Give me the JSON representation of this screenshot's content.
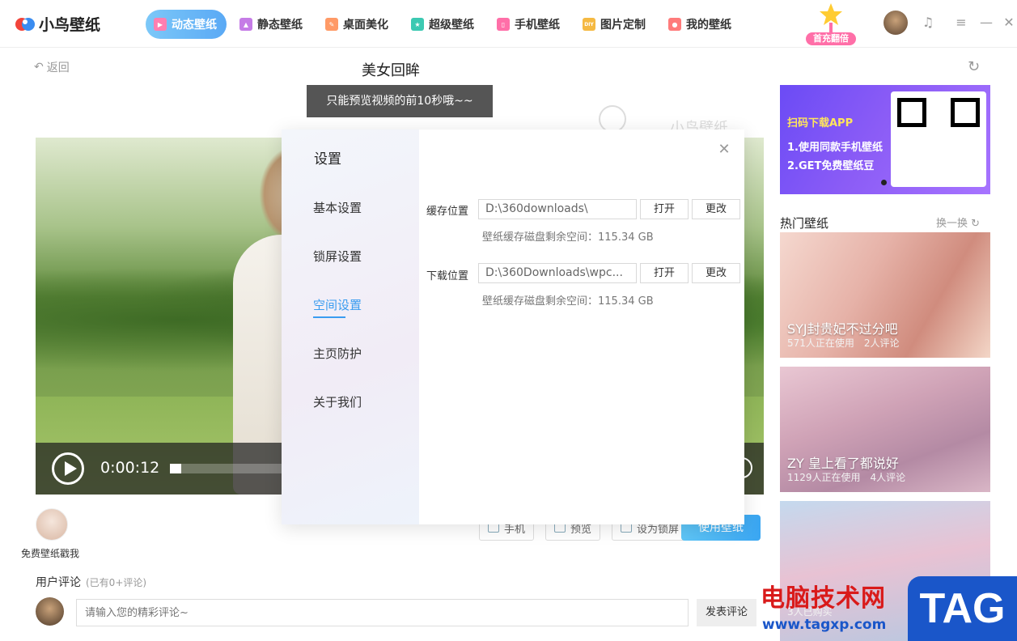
{
  "app": {
    "logo_text": "小鸟壁纸",
    "promo_label": "首充翻倍"
  },
  "nav": [
    {
      "label": "动态壁纸",
      "icon": "video-play-icon",
      "color": "#ffffff",
      "active": true
    },
    {
      "label": "静态壁纸",
      "icon": "image-icon",
      "color": "#c57ce6"
    },
    {
      "label": "桌面美化",
      "icon": "brush-icon",
      "color": "#ff9a66"
    },
    {
      "label": "超级壁纸",
      "icon": "star-icon",
      "color": "#3cc9b2"
    },
    {
      "label": "手机壁纸",
      "icon": "phone-icon",
      "color": "#ff6fa8"
    },
    {
      "label": "图片定制",
      "icon": "diy-icon",
      "color": "#f5b942"
    },
    {
      "label": "我的壁纸",
      "icon": "user-icon",
      "color": "#ff7b7b"
    }
  ],
  "header": {
    "back_label": "返回",
    "title": "美女回眸"
  },
  "toast": "只能预览视频的前10秒哦~~",
  "watermark_text": "小鸟壁纸",
  "player": {
    "time": "0:00:12",
    "progress": 0.02
  },
  "below_video": {
    "free_label": "免费壁纸戳我",
    "actions": [
      "手机",
      "预览",
      "设为锁屏"
    ],
    "use_button": "使用壁纸"
  },
  "comments": {
    "title": "用户评论",
    "count": "(已有0+评论)",
    "placeholder": "请输入您的精彩评论~",
    "submit": "发表评论"
  },
  "banner": {
    "line1": "扫码下载APP",
    "line2": "1.使用同款手机壁纸",
    "line3": "2.GET免费壁纸豆"
  },
  "hot": {
    "title": "热门壁纸",
    "refresh_label": "换一换",
    "cards": [
      {
        "title": "SYJ封贵妃不过分吧",
        "users": "571人正在使用",
        "comments": "2人评论"
      },
      {
        "title": "ZY 皇上看了都说好",
        "users": "1129人正在使用",
        "comments": "4人评论"
      },
      {
        "title": "",
        "users": "3人已购买",
        "comments": ""
      }
    ]
  },
  "settings": {
    "title": "设置",
    "menu": [
      "基本设置",
      "锁屏设置",
      "空间设置",
      "主页防护",
      "关于我们"
    ],
    "active_index": 2,
    "cache": {
      "label": "缓存位置",
      "path": "D:\\360downloads\\",
      "open": "打开",
      "change": "更改",
      "space_note": "壁纸缓存磁盘剩余空间：115.34 GB"
    },
    "download": {
      "label": "下载位置",
      "path": "D:\\360Downloads\\wpc...",
      "open": "打开",
      "change": "更改",
      "space_note": "壁纸缓存磁盘剩余空间：115.34 GB"
    }
  },
  "site_watermark": {
    "cn": "电脑技术网",
    "url": "www.tagxp.com",
    "tag": "TAG"
  },
  "colors": {
    "accent": "#3a9cf0",
    "nav_active": "#5aa9f5",
    "watermark_red": "#d91a1a",
    "watermark_blue": "#1a56c9"
  }
}
